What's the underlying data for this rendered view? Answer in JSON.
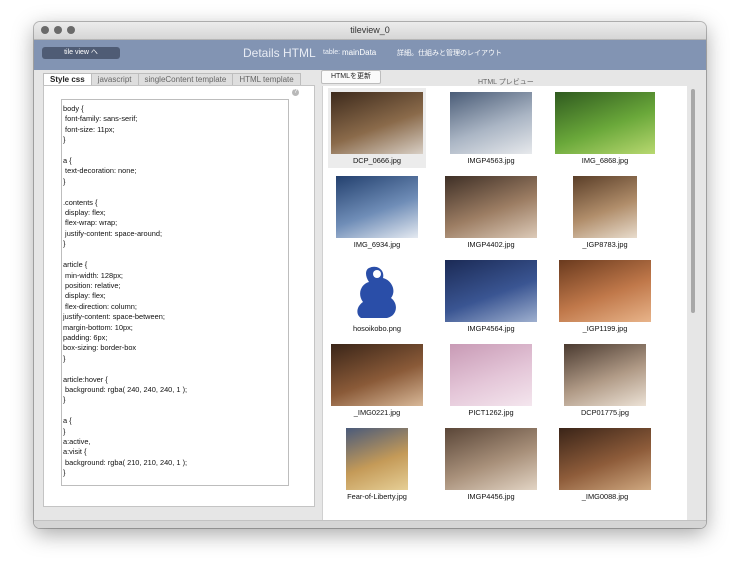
{
  "window": {
    "title": "tileview_0"
  },
  "header": {
    "tileview_button": "tile view へ",
    "title": "Details HTML",
    "table_key": "table:",
    "table_value": "mainData",
    "description": "詳細。仕組みと管理のレイアウト"
  },
  "left_tabs": [
    "Style css",
    "javascript",
    "singleContent template",
    "HTML template"
  ],
  "css_code": "body {\n font-family: sans-serif;\n font-size: 11px;\n}\n\na {\n text-decoration: none;\n}\n\n.contents {\n display: flex;\n flex-wrap: wrap;\n justify-content: space-around;\n}\n\narticle {\n min-width: 128px;\n position: relative;\n display: flex;\n flex-direction: column;\njustify-content: space-between;\nmargin-bottom: 10px;\npadding: 6px;\nbox-sizing: border-box\n}\n\narticle:hover {\n background: rgba( 240, 240, 240, 1 );\n}\n\na {\n}\na:active,\na:visit {\n background: rgba( 210, 210, 240, 1 );\n}",
  "preview": {
    "update_button": "HTMLを更新",
    "label": "HTML プレビュー",
    "tiles": [
      {
        "filename": "DCP_0666.jpg",
        "icon": "photo-cat-on-table",
        "colors": [
          "#3d2a1c",
          "#8a6a4a",
          "#d8cfc5"
        ]
      },
      {
        "filename": "IMGP4563.jpg",
        "icon": "photo-clouds-sky",
        "colors": [
          "#4a5c77",
          "#aab5c4",
          "#e7e9ec"
        ]
      },
      {
        "filename": "IMG_6868.jpg",
        "icon": "photo-green-leaves",
        "colors": [
          "#2f5a1f",
          "#6aa83a",
          "#b8d870"
        ]
      },
      {
        "filename": "IMG_6934.jpg",
        "icon": "photo-cloudy-sky",
        "colors": [
          "#23406e",
          "#6f8db7",
          "#e5eaf1"
        ]
      },
      {
        "filename": "IMGP4402.jpg",
        "icon": "photo-cat-face",
        "colors": [
          "#3e2f26",
          "#9c7d63",
          "#dccab8"
        ]
      },
      {
        "filename": "_IGP8783.jpg",
        "icon": "photo-cat-doorway",
        "colors": [
          "#5a3e28",
          "#b08d6a",
          "#e8dccd"
        ]
      },
      {
        "filename": "hosoikobo.png",
        "icon": "logo-blue-figure",
        "colors": [
          "#ffffff",
          "#2a4ea8",
          "#ffffff"
        ]
      },
      {
        "filename": "IMGP4564.jpg",
        "icon": "photo-evening-sky",
        "colors": [
          "#1b2a55",
          "#3a5592",
          "#9fb0cf"
        ]
      },
      {
        "filename": "_IGP1199.jpg",
        "icon": "photo-sleeping-cat",
        "colors": [
          "#6a3a1e",
          "#c0784a",
          "#e8b48a"
        ]
      },
      {
        "filename": "_IMG0221.jpg",
        "icon": "photo-cat-closeup",
        "colors": [
          "#3a2518",
          "#8a5a38",
          "#d8b898"
        ]
      },
      {
        "filename": "PICT1262.jpg",
        "icon": "photo-cherry-blossoms",
        "colors": [
          "#c89ab5",
          "#e4c6d8",
          "#f4e6ee"
        ]
      },
      {
        "filename": "DCP01775.jpg",
        "icon": "photo-two-cats",
        "colors": [
          "#4a3a30",
          "#b09a86",
          "#ece2d6"
        ]
      },
      {
        "filename": "Fear-of-Liberty.jpg",
        "icon": "photo-book-cover",
        "colors": [
          "#4a5a7a",
          "#c49a58",
          "#e6cf96"
        ]
      },
      {
        "filename": "IMGP4456.jpg",
        "icon": "photo-cat-face-close",
        "colors": [
          "#5a4638",
          "#a8907a",
          "#e2d4c4"
        ]
      },
      {
        "filename": "_IMG0088.jpg",
        "icon": "photo-cat-sitting",
        "colors": [
          "#3a2418",
          "#8e5c3a",
          "#cfa880"
        ]
      }
    ]
  }
}
